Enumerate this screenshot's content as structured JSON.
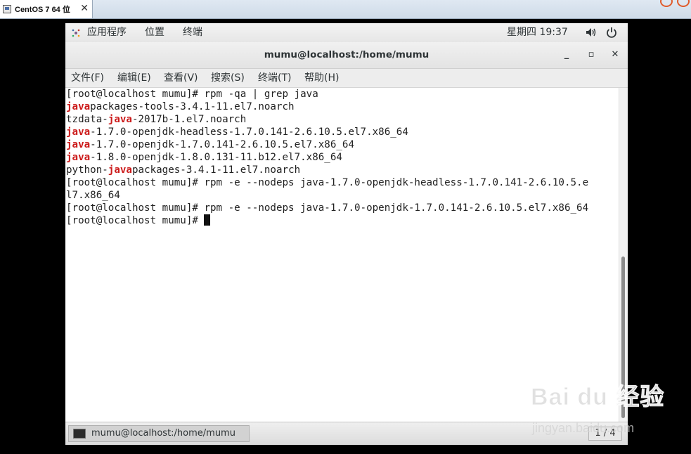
{
  "vm": {
    "tab_title": "CentOS 7 64 位",
    "tab_close": "✕"
  },
  "topbar": {
    "applications": "应用程序",
    "places": "位置",
    "terminal": "终端",
    "clock": "星期四 19:37"
  },
  "window": {
    "title": "mumu@localhost:/home/mumu",
    "minimize": "_",
    "maximize": "▫",
    "close": "✕"
  },
  "menu": {
    "file": "文件(F)",
    "edit": "编辑(E)",
    "view": "查看(V)",
    "search": "搜索(S)",
    "terminal": "终端(T)",
    "help": "帮助(H)"
  },
  "terminal_lines": {
    "l1": "[root@localhost mumu]# rpm -qa | grep java",
    "l2a": "java",
    "l2b": "packages-tools-3.4.1-11.el7.noarch",
    "l3a": "tzdata-",
    "l3b": "java",
    "l3c": "-2017b-1.el7.noarch",
    "l4a": "java",
    "l4b": "-1.7.0-openjdk-headless-1.7.0.141-2.6.10.5.el7.x86_64",
    "l5a": "java",
    "l5b": "-1.7.0-openjdk-1.7.0.141-2.6.10.5.el7.x86_64",
    "l6a": "java",
    "l6b": "-1.8.0-openjdk-1.8.0.131-11.b12.el7.x86_64",
    "l7a": "python-",
    "l7b": "java",
    "l7c": "packages-3.4.1-11.el7.noarch",
    "l8": "[root@localhost mumu]# rpm -e --nodeps java-1.7.0-openjdk-headless-1.7.0.141-2.6.10.5.e",
    "l9": "l7.x86_64",
    "l10": "[root@localhost mumu]# rpm -e --nodeps java-1.7.0-openjdk-1.7.0.141-2.6.10.5.el7.x86_64",
    "l11": "[root@localhost mumu]# "
  },
  "taskbar": {
    "task_label": "mumu@localhost:/home/mumu",
    "workspace": "1 / 4"
  },
  "watermark": {
    "brand": "Bai du 经验",
    "url": "jingyan.baidu.com"
  },
  "colors": {
    "highlight": "#cc1b1b",
    "desktop_bg": "#000000"
  }
}
